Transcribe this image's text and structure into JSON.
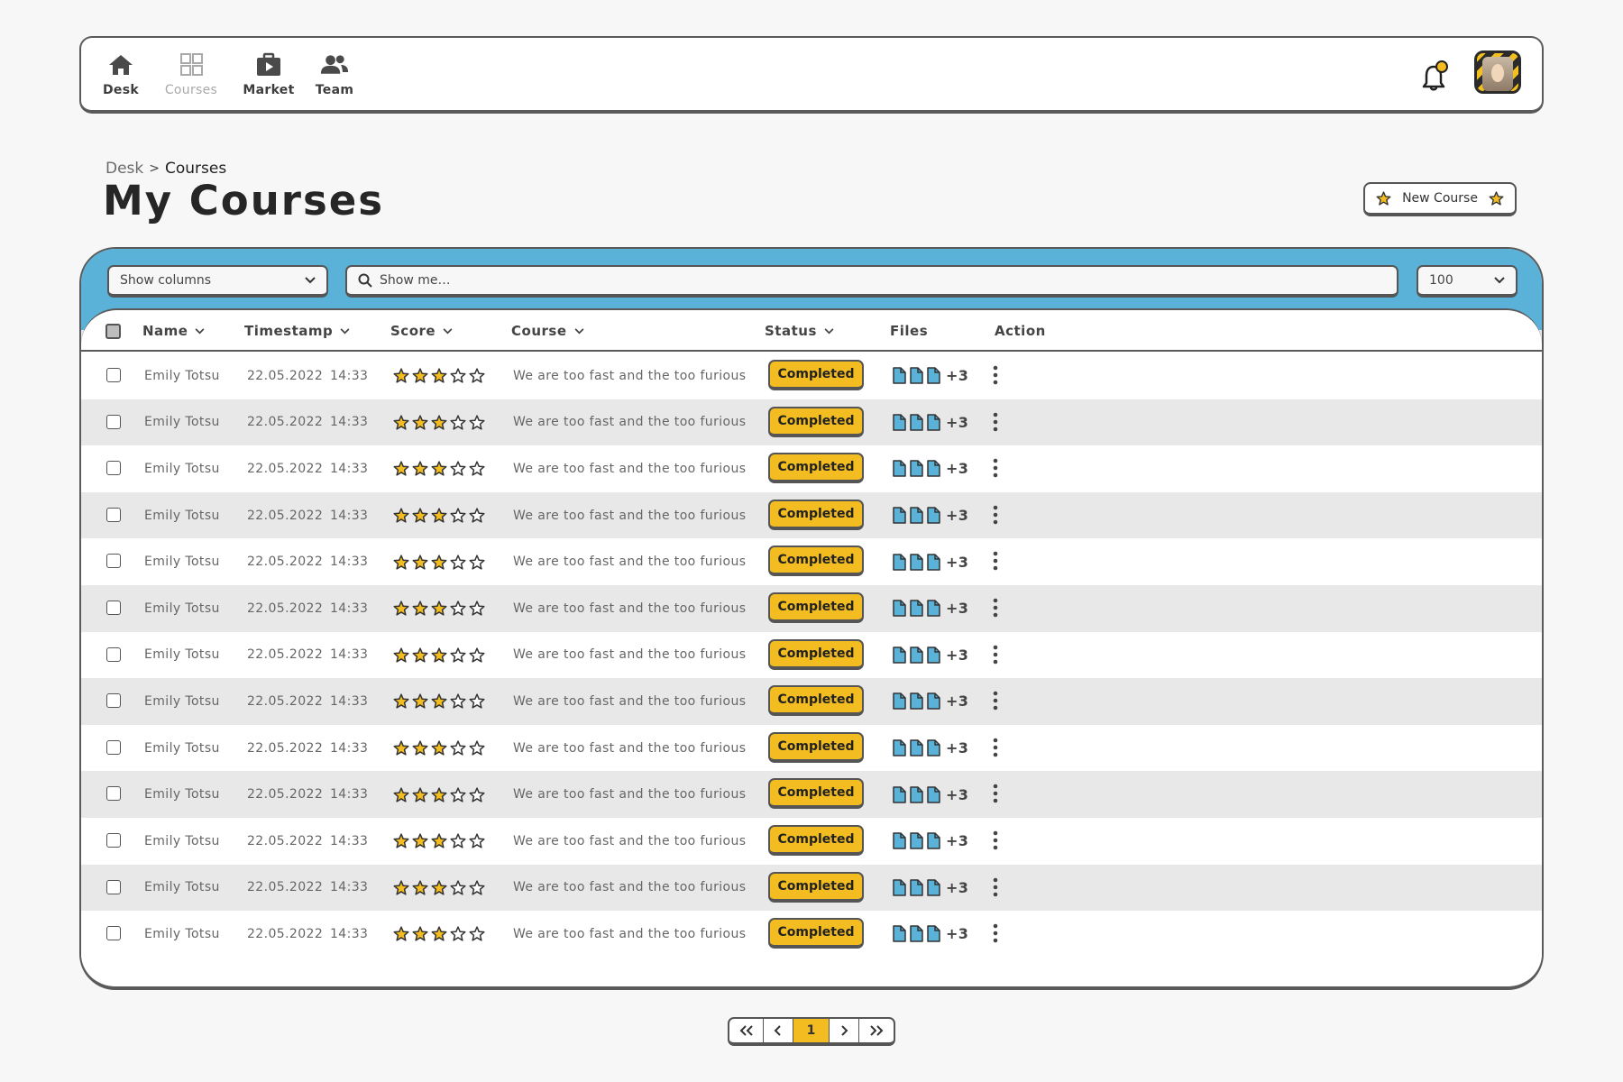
{
  "nav": {
    "items": [
      {
        "label": "Desk",
        "icon": "home-icon",
        "active": true
      },
      {
        "label": "Courses",
        "icon": "grid-icon",
        "active": false
      },
      {
        "label": "Market",
        "icon": "briefcase-play-icon",
        "active": true
      },
      {
        "label": "Team",
        "icon": "users-icon",
        "active": true
      }
    ],
    "notifications_icon": "bell-icon",
    "avatar_icon": "user-avatar"
  },
  "breadcrumb": {
    "root": "Desk",
    "separator": ">",
    "current": "Courses"
  },
  "page_title": "My Courses",
  "new_course_button": {
    "label": "New Course",
    "icon": "star-icon"
  },
  "toolbar": {
    "columns_select": "Show columns",
    "search_placeholder": "Show me…",
    "per_page": "100"
  },
  "table": {
    "columns": [
      "Name",
      "Timestamp",
      "Score",
      "Course",
      "Status",
      "Files",
      "Action"
    ],
    "rows": [
      {
        "name": "Emily Totsu",
        "date": "22.05.2022",
        "time": "14:33",
        "score": 3,
        "course": "We are too fast and the too furious",
        "status": "Completed",
        "files_shown": 3,
        "files_more": "+3"
      },
      {
        "name": "Emily Totsu",
        "date": "22.05.2022",
        "time": "14:33",
        "score": 3,
        "course": "We are too fast and the too furious",
        "status": "Completed",
        "files_shown": 3,
        "files_more": "+3"
      },
      {
        "name": "Emily Totsu",
        "date": "22.05.2022",
        "time": "14:33",
        "score": 3,
        "course": "We are too fast and the too furious",
        "status": "Completed",
        "files_shown": 3,
        "files_more": "+3"
      },
      {
        "name": "Emily Totsu",
        "date": "22.05.2022",
        "time": "14:33",
        "score": 3,
        "course": "We are too fast and the too furious",
        "status": "Completed",
        "files_shown": 3,
        "files_more": "+3"
      },
      {
        "name": "Emily Totsu",
        "date": "22.05.2022",
        "time": "14:33",
        "score": 3,
        "course": "We are too fast and the too furious",
        "status": "Completed",
        "files_shown": 3,
        "files_more": "+3"
      },
      {
        "name": "Emily Totsu",
        "date": "22.05.2022",
        "time": "14:33",
        "score": 3,
        "course": "We are too fast and the too furious",
        "status": "Completed",
        "files_shown": 3,
        "files_more": "+3"
      },
      {
        "name": "Emily Totsu",
        "date": "22.05.2022",
        "time": "14:33",
        "score": 3,
        "course": "We are too fast and the too furious",
        "status": "Completed",
        "files_shown": 3,
        "files_more": "+3"
      },
      {
        "name": "Emily Totsu",
        "date": "22.05.2022",
        "time": "14:33",
        "score": 3,
        "course": "We are too fast and the too furious",
        "status": "Completed",
        "files_shown": 3,
        "files_more": "+3"
      },
      {
        "name": "Emily Totsu",
        "date": "22.05.2022",
        "time": "14:33",
        "score": 3,
        "course": "We are too fast and the too furious",
        "status": "Completed",
        "files_shown": 3,
        "files_more": "+3"
      },
      {
        "name": "Emily Totsu",
        "date": "22.05.2022",
        "time": "14:33",
        "score": 3,
        "course": "We are too fast and the too furious",
        "status": "Completed",
        "files_shown": 3,
        "files_more": "+3"
      },
      {
        "name": "Emily Totsu",
        "date": "22.05.2022",
        "time": "14:33",
        "score": 3,
        "course": "We are too fast and the too furious",
        "status": "Completed",
        "files_shown": 3,
        "files_more": "+3"
      },
      {
        "name": "Emily Totsu",
        "date": "22.05.2022",
        "time": "14:33",
        "score": 3,
        "course": "We are too fast and the too furious",
        "status": "Completed",
        "files_shown": 3,
        "files_more": "+3"
      },
      {
        "name": "Emily Totsu",
        "date": "22.05.2022",
        "time": "14:33",
        "score": 3,
        "course": "We are too fast and the too furious",
        "status": "Completed",
        "files_shown": 3,
        "files_more": "+3"
      }
    ],
    "max_score": 5
  },
  "pagination": {
    "current": "1"
  },
  "colors": {
    "accent_yellow": "#f3bc20",
    "toolbar_blue": "#5ab2d9",
    "file_blue": "#5ab2d9",
    "border_dark": "#5a5a5a"
  }
}
